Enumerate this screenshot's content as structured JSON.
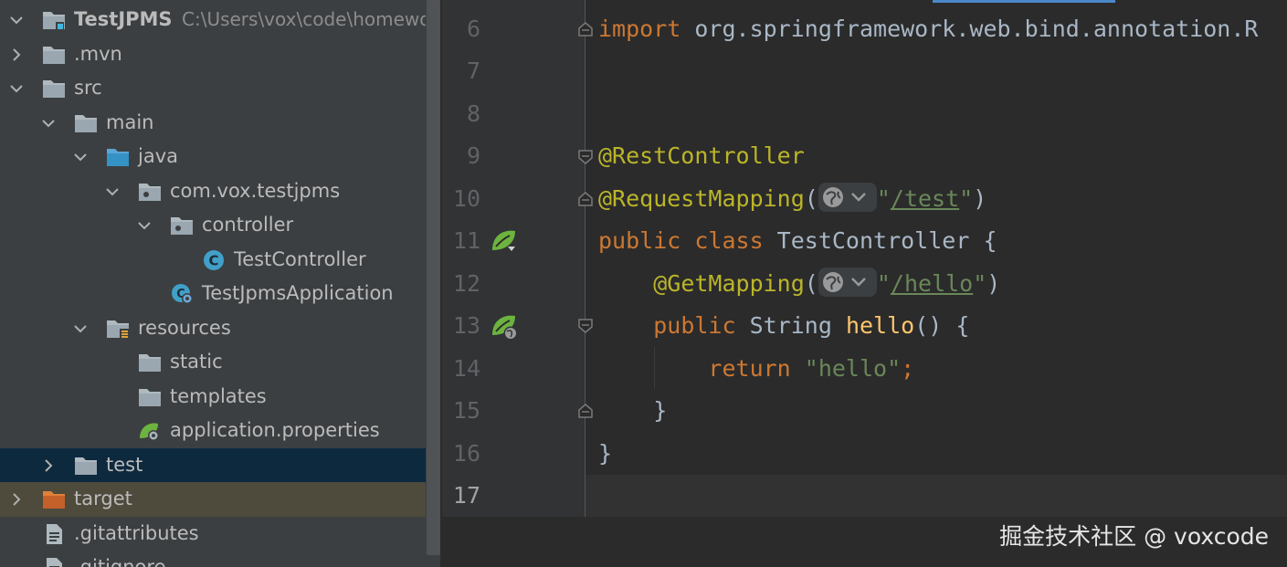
{
  "project": {
    "name": "TestJPMS",
    "path": "C:\\Users\\vox\\code\\homework\\T",
    "items": [
      {
        "label": "TestJPMS",
        "depth": 0,
        "arrow": "down",
        "icon": "module-folder-icon"
      },
      {
        "label": ".mvn",
        "depth": 0,
        "arrow": "right",
        "icon": "folder-icon"
      },
      {
        "label": "src",
        "depth": 0,
        "arrow": "down",
        "icon": "folder-icon"
      },
      {
        "label": "main",
        "depth": 1,
        "arrow": "down",
        "icon": "folder-icon"
      },
      {
        "label": "java",
        "depth": 2,
        "arrow": "down",
        "icon": "source-root-folder-icon"
      },
      {
        "label": "com.vox.testjpms",
        "depth": 3,
        "arrow": "down",
        "icon": "package-icon"
      },
      {
        "label": "controller",
        "depth": 4,
        "arrow": "down",
        "icon": "package-icon"
      },
      {
        "label": "TestController",
        "depth": 5,
        "arrow": "none",
        "icon": "class-icon"
      },
      {
        "label": "TestJpmsApplication",
        "depth": 4,
        "arrow": "none",
        "icon": "spring-boot-app-icon"
      },
      {
        "label": "resources",
        "depth": 2,
        "arrow": "down",
        "icon": "resources-folder-icon"
      },
      {
        "label": "static",
        "depth": 3,
        "arrow": "none",
        "icon": "folder-icon"
      },
      {
        "label": "templates",
        "depth": 3,
        "arrow": "none",
        "icon": "folder-icon"
      },
      {
        "label": "application.properties",
        "depth": 3,
        "arrow": "none",
        "icon": "spring-properties-icon"
      },
      {
        "label": "test",
        "depth": 1,
        "arrow": "right",
        "icon": "folder-icon",
        "state": "selected"
      },
      {
        "label": "target",
        "depth": 0,
        "arrow": "right",
        "icon": "excluded-folder-icon",
        "state": "excluded"
      },
      {
        "label": ".gitattributes",
        "depth": 0,
        "arrow": "none",
        "icon": "text-file-icon"
      },
      {
        "label": ".gitignore",
        "depth": 0,
        "arrow": "none",
        "icon": "text-file-icon"
      }
    ]
  },
  "editor": {
    "lines": [
      {
        "n": "6",
        "tokens": [
          {
            "t": "import",
            "c": "kw"
          },
          {
            "t": " org.springframework.web.bind.annotation.R",
            "c": ""
          }
        ]
      },
      {
        "n": "7",
        "tokens": []
      },
      {
        "n": "8",
        "tokens": []
      },
      {
        "n": "9",
        "tokens": [
          {
            "t": "@RestController",
            "c": "ann"
          }
        ]
      },
      {
        "n": "10",
        "tokens": [
          {
            "t": "@RequestMapping",
            "c": "ann"
          },
          {
            "t": "(",
            "c": ""
          },
          {
            "t": "",
            "c": "web"
          },
          {
            "t": "\"",
            "c": "str"
          },
          {
            "t": "/test",
            "c": "str url"
          },
          {
            "t": "\"",
            "c": "str"
          },
          {
            "t": ")",
            "c": ""
          }
        ]
      },
      {
        "n": "11",
        "tokens": [
          {
            "t": "public class ",
            "c": "kw"
          },
          {
            "t": "TestController {",
            "c": ""
          }
        ]
      },
      {
        "n": "12",
        "tokens": [
          {
            "t": "    ",
            "c": ""
          },
          {
            "t": "@GetMapping",
            "c": "ann"
          },
          {
            "t": "(",
            "c": ""
          },
          {
            "t": "",
            "c": "web"
          },
          {
            "t": "\"",
            "c": "str"
          },
          {
            "t": "/hello",
            "c": "str url"
          },
          {
            "t": "\"",
            "c": "str"
          },
          {
            "t": ")",
            "c": ""
          }
        ]
      },
      {
        "n": "13",
        "tokens": [
          {
            "t": "    ",
            "c": ""
          },
          {
            "t": "public ",
            "c": "kw"
          },
          {
            "t": "String ",
            "c": ""
          },
          {
            "t": "hello",
            "c": "fn"
          },
          {
            "t": "() {",
            "c": ""
          }
        ]
      },
      {
        "n": "14",
        "tokens": [
          {
            "t": "        ",
            "c": ""
          },
          {
            "t": "return ",
            "c": "kw"
          },
          {
            "t": "\"hello\"",
            "c": "str"
          },
          {
            "t": ";",
            "c": "kw"
          }
        ]
      },
      {
        "n": "15",
        "tokens": [
          {
            "t": "    }",
            "c": ""
          }
        ]
      },
      {
        "n": "16",
        "tokens": [
          {
            "t": "}",
            "c": ""
          }
        ]
      },
      {
        "n": "17",
        "tokens": []
      }
    ],
    "current_line": "17"
  },
  "watermark": "掘金技术社区 @ voxcode",
  "colors": {
    "tree_bg": "#3c3f41",
    "editor_bg": "#2b2b2b",
    "gutter_bg": "#313335",
    "selection": "#0d293e",
    "excluded": "#4e4a3c",
    "keyword": "#cc7832",
    "annotation": "#bbb529",
    "string": "#6a8759",
    "method": "#ffc66d",
    "text": "#a9b7c6",
    "spring_green": "#6db33f"
  }
}
